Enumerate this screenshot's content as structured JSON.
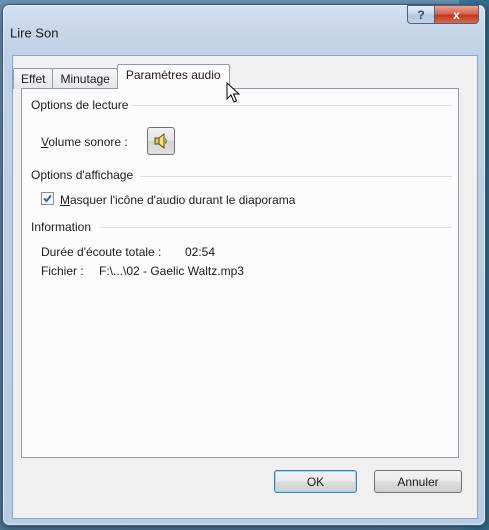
{
  "window": {
    "title": "Lire Son",
    "help_label": "?",
    "close_label": "x"
  },
  "tabs": [
    {
      "label": "Effet",
      "active": false
    },
    {
      "label": "Minutage",
      "active": false
    },
    {
      "label": "Paramètres audio",
      "active": true
    }
  ],
  "playback": {
    "group_title": "Options de lecture",
    "volume_label_accel": "V",
    "volume_label_rest": "olume sonore :",
    "volume_icon": "speaker-icon"
  },
  "display": {
    "group_title": "Options d'affichage",
    "hide_icon_accel": "M",
    "hide_icon_rest": "asquer l'icône d'audio durant le diaporama",
    "hide_icon_checked": true
  },
  "information": {
    "group_title": "Information",
    "duration_label": "Durée d'écoute totale :",
    "duration_value": "02:54",
    "file_label": "Fichier :",
    "file_value": "F:\\...\\02 - Gaelic Waltz.mp3"
  },
  "footer": {
    "ok_label": "OK",
    "cancel_label": "Annuler"
  },
  "colors": {
    "accent": "#3c7fb1",
    "close_red": "#c23a1f"
  }
}
